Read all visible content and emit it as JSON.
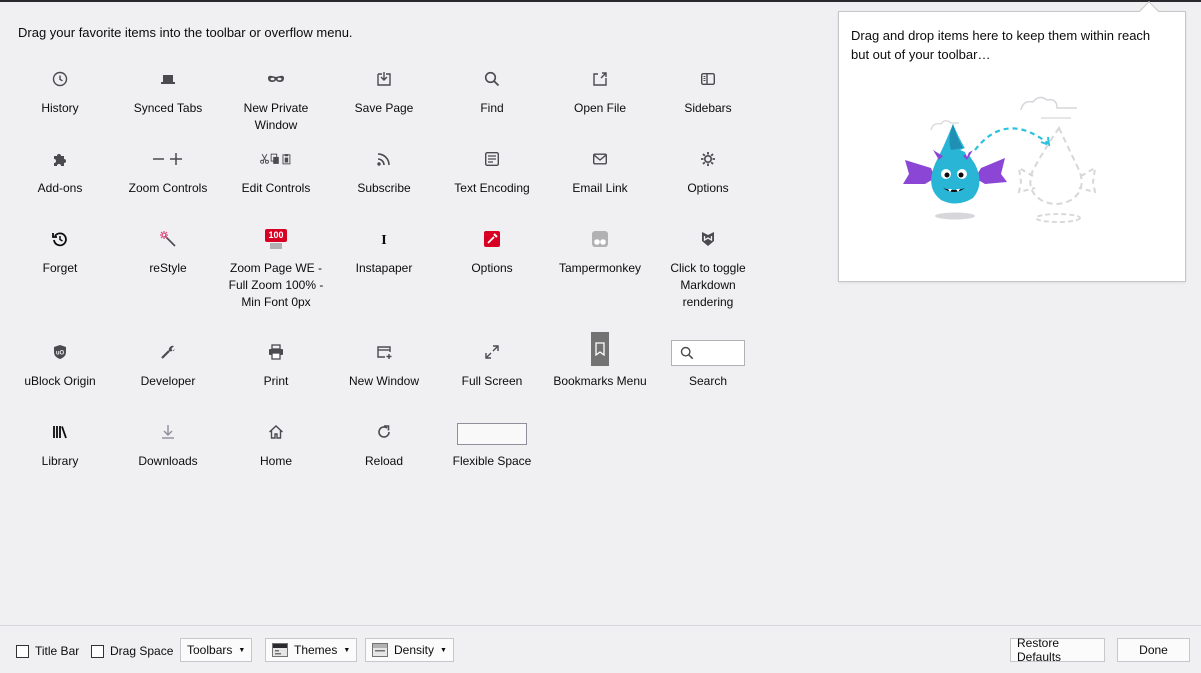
{
  "instructions": "Drag your favorite items into the toolbar or overflow menu.",
  "palette": {
    "row1": [
      {
        "label": "History",
        "icon": "history-icon"
      },
      {
        "label": "Synced Tabs",
        "icon": "synced-tabs-icon"
      },
      {
        "label": "New Private Window",
        "icon": "private-window-icon"
      },
      {
        "label": "Save Page",
        "icon": "save-page-icon"
      },
      {
        "label": "Find",
        "icon": "find-icon"
      },
      {
        "label": "Open File",
        "icon": "open-file-icon"
      },
      {
        "label": "Sidebars",
        "icon": "sidebars-icon"
      }
    ],
    "row2": [
      {
        "label": "Add-ons",
        "icon": "addons-icon"
      },
      {
        "label": "Zoom Controls",
        "icon": "zoom-controls-icon"
      },
      {
        "label": "Edit Controls",
        "icon": "edit-controls-icon"
      },
      {
        "label": "Subscribe",
        "icon": "subscribe-icon"
      },
      {
        "label": "Text Encoding",
        "icon": "text-encoding-icon"
      },
      {
        "label": "Email Link",
        "icon": "email-link-icon"
      },
      {
        "label": "Options",
        "icon": "options-gear-icon"
      }
    ],
    "row3": [
      {
        "label": "Forget",
        "icon": "forget-icon"
      },
      {
        "label": "reStyle",
        "icon": "restyle-icon"
      },
      {
        "label": "Zoom Page WE - Full Zoom 100% - Min Font 0px",
        "icon": "zoom-page-icon",
        "badge": "100"
      },
      {
        "label": "Instapaper",
        "icon": "instapaper-icon"
      },
      {
        "label": "Options",
        "icon": "options-red-icon"
      },
      {
        "label": "Tampermonkey",
        "icon": "tampermonkey-icon"
      },
      {
        "label": "Click to toggle Markdown rendering",
        "icon": "markdown-icon"
      }
    ],
    "row4": [
      {
        "label": "uBlock Origin",
        "icon": "ublock-icon"
      },
      {
        "label": "Developer",
        "icon": "developer-wrench-icon"
      },
      {
        "label": "Print",
        "icon": "print-icon"
      },
      {
        "label": "New Window",
        "icon": "new-window-icon"
      },
      {
        "label": "Full Screen",
        "icon": "fullscreen-icon"
      },
      {
        "label": "Bookmarks Menu",
        "icon": "bookmarks-menu-icon"
      },
      {
        "label": "Search",
        "icon": "search-box-icon"
      }
    ],
    "row5": [
      {
        "label": "Library",
        "icon": "library-icon"
      },
      {
        "label": "Downloads",
        "icon": "downloads-icon"
      },
      {
        "label": "Home",
        "icon": "home-icon"
      },
      {
        "label": "Reload",
        "icon": "reload-icon"
      },
      {
        "label": "Flexible Space",
        "icon": "flexible-space"
      }
    ]
  },
  "overflow": {
    "text": "Drag and drop items here to keep them within reach but out of your toolbar…"
  },
  "footer": {
    "title_bar": "Title Bar",
    "drag_space": "Drag Space",
    "toolbars": "Toolbars",
    "themes": "Themes",
    "density": "Density",
    "restore": "Restore Defaults",
    "done": "Done"
  },
  "colors": {
    "background": "#f0f0f2",
    "icon_gray": "#4a4a4f",
    "dragon_blue": "#29b6d6",
    "dragon_purple": "#8c46d6",
    "zoom_badge": "#d70022"
  }
}
